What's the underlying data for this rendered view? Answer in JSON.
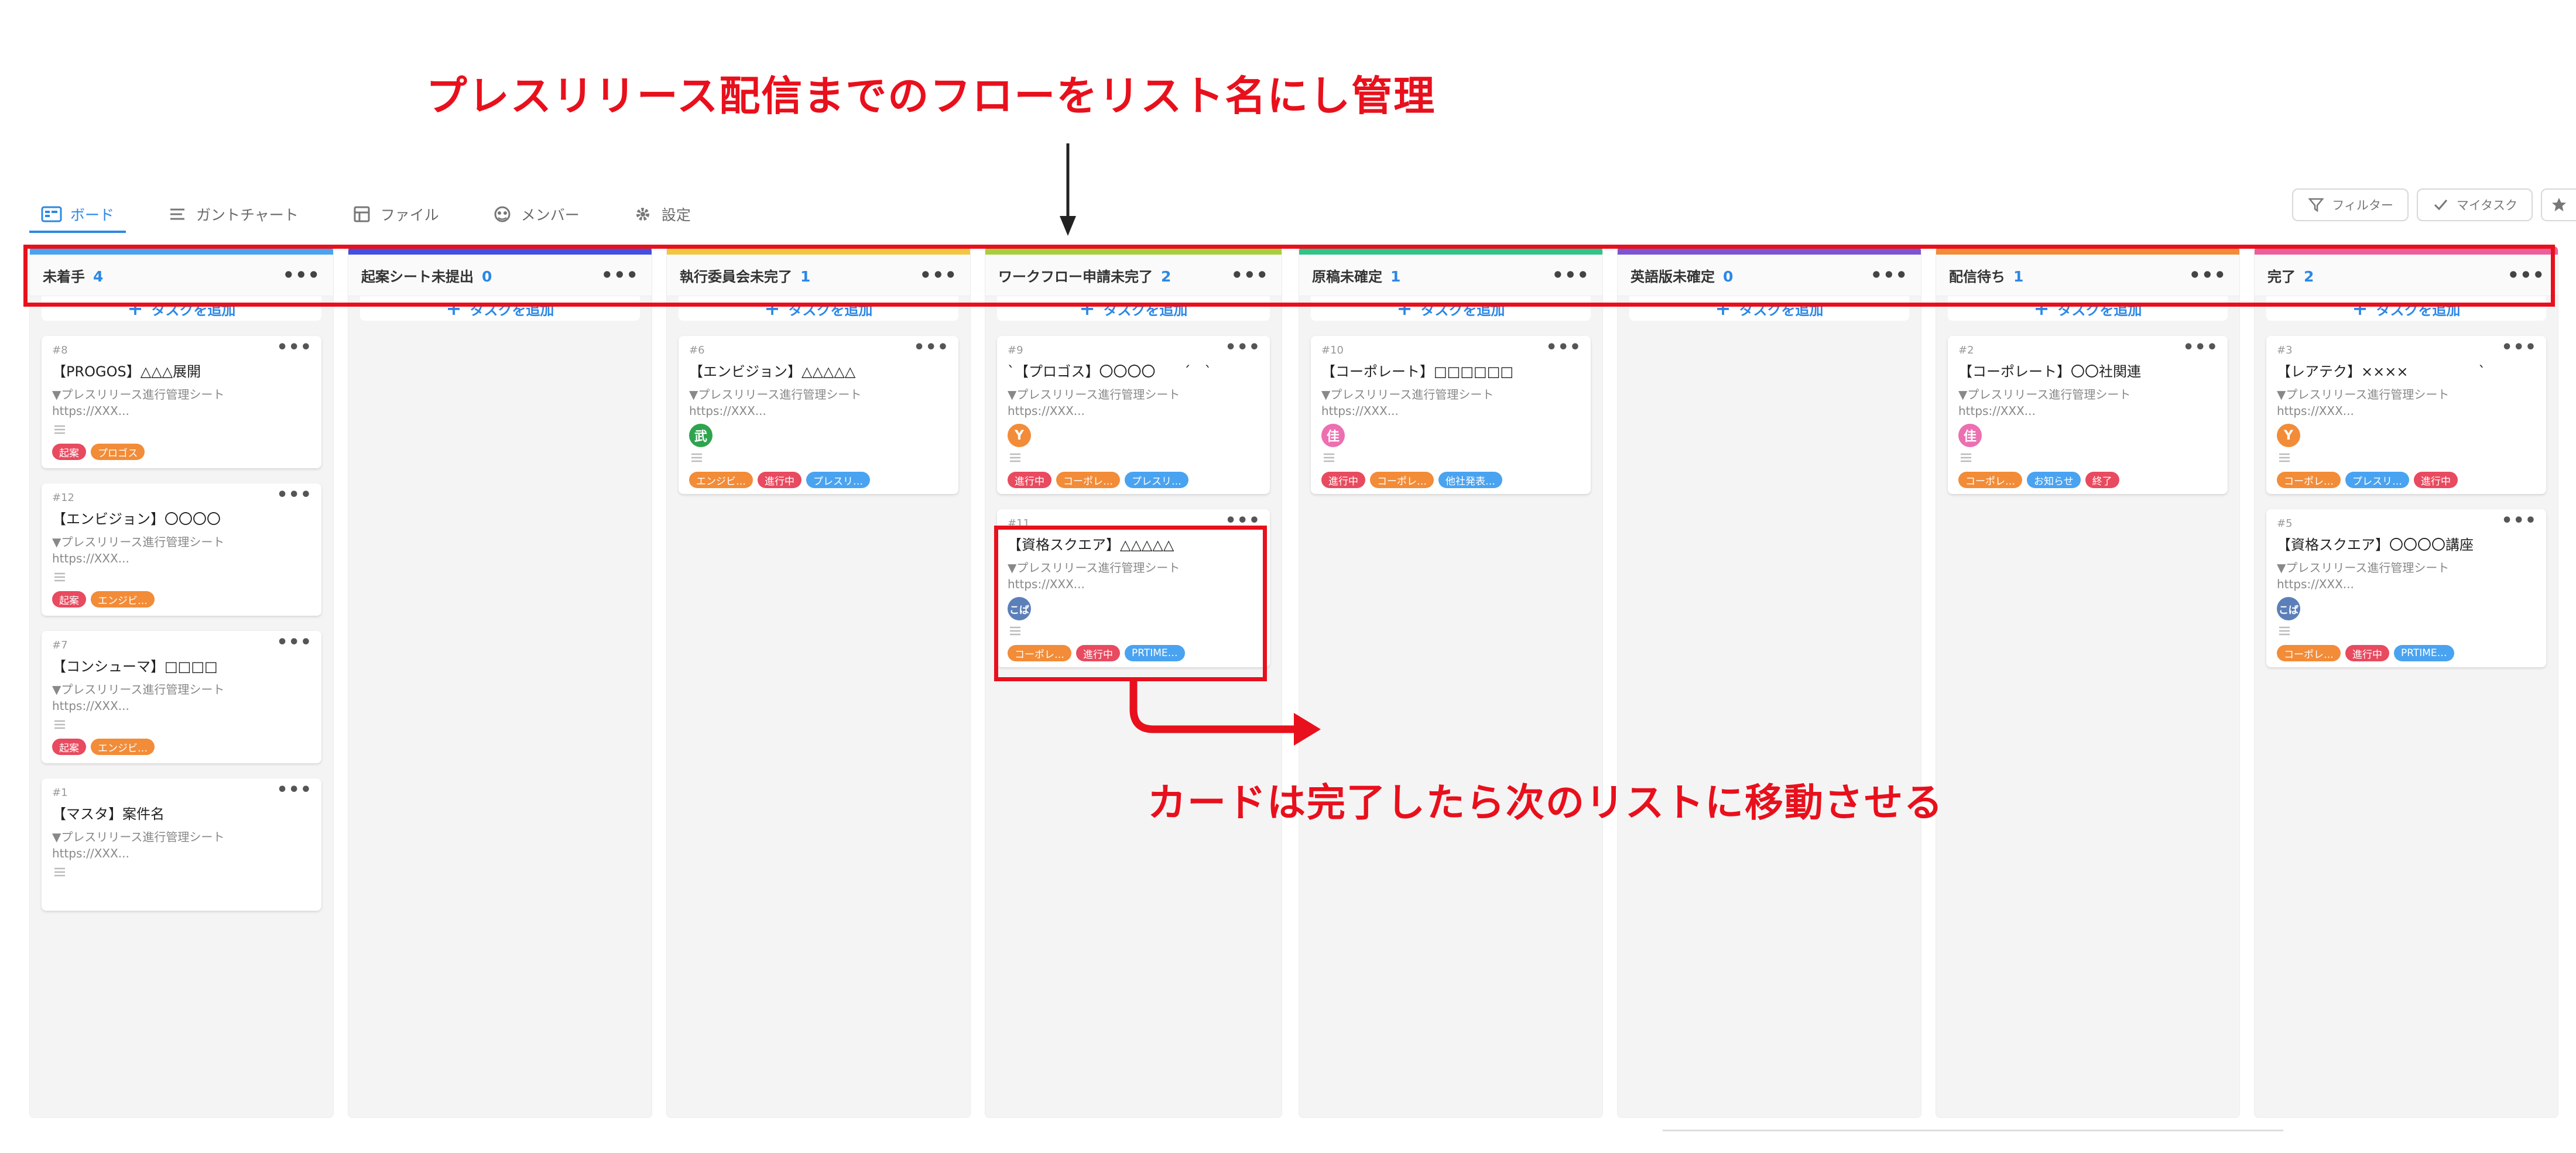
{
  "annotations": {
    "top": "プレスリリース配信までのフローをリスト名にし管理",
    "bottom": "カードは完了したら次のリストに移動させる"
  },
  "tabs": [
    {
      "label": "ボード",
      "icon": "board-icon"
    },
    {
      "label": "ガントチャート",
      "icon": "gantt-list-icon"
    },
    {
      "label": "ファイル",
      "icon": "file-icon"
    },
    {
      "label": "メンバー",
      "icon": "members-icon"
    },
    {
      "label": "設定",
      "icon": "gear-icon"
    }
  ],
  "tools": {
    "filter": "フィルター",
    "mytask": "マイタスク"
  },
  "add_task_label": "タスクを追加",
  "desc_line1": "▼プレスリリース進行管理シート",
  "desc_line2": "https://XXX...",
  "tag_colors": {
    "起案": "#e84a5f",
    "プロゴス": "#f28c38",
    "エンジビ…": "#f28c38",
    "進行中": "#e84a5f",
    "プレスリ…": "#4aa3f0",
    "コーポレ…": "#f28c38",
    "他社発表…": "#4aa3f0",
    "お知らせ": "#4aa3f0",
    "終了": "#e84a5f",
    "PRTIME…": "#4aa3f0"
  },
  "columns": [
    {
      "name": "未着手",
      "count": "4",
      "color": "#4aa3f0",
      "cards": [
        {
          "id": "#8",
          "title": "【PROGOS】△△△展開",
          "tags": [
            "起案",
            "プロゴス"
          ]
        },
        {
          "id": "#12",
          "title": "【エンビジョン】〇〇〇〇",
          "tags": [
            "起案",
            "エンジビ…"
          ]
        },
        {
          "id": "#7",
          "title": "【コンシューマ】□□□□",
          "tags": [
            "起案",
            "エンジビ…"
          ]
        },
        {
          "id": "#1",
          "title": "【マスタ】案件名",
          "tags": []
        }
      ]
    },
    {
      "name": "起案シート未提出",
      "count": "0",
      "color": "#4450e0",
      "cards": []
    },
    {
      "name": "執行委員会未完了",
      "count": "1",
      "color": "#f2c740",
      "cards": [
        {
          "id": "#6",
          "title": "【エンビジョン】△△△△△",
          "avatar": "武",
          "avatar_color": "#2ea44f",
          "tags": [
            "エンジビ…",
            "進行中",
            "プレスリ…"
          ]
        }
      ]
    },
    {
      "name": "ワークフロー申請未完了",
      "count": "2",
      "color": "#a6cf3c",
      "cards": [
        {
          "id": "#9",
          "title": "ˋ【プロゴス】〇〇〇〇　　ˊ　ˋ",
          "avatar": "Y",
          "avatar_color": "#f28c38",
          "tags": [
            "進行中",
            "コーポレ…",
            "プレスリ…"
          ]
        },
        {
          "id": "#11",
          "title": "【資格スクエア】△△△△△",
          "avatar": "こば",
          "avatar_color": "#5b7fb8",
          "tags": [
            "コーポレ…",
            "進行中",
            "PRTIME…"
          ]
        }
      ]
    },
    {
      "name": "原稿未確定",
      "count": "1",
      "color": "#2fc48a",
      "cards": [
        {
          "id": "#10",
          "title": "【コーポレート】□□□□□□",
          "avatar": "佳",
          "avatar_color": "#ec6fb1",
          "tags": [
            "進行中",
            "コーポレ…",
            "他社発表…"
          ]
        }
      ]
    },
    {
      "name": "英語版未確定",
      "count": "0",
      "color": "#7a55d4",
      "cards": []
    },
    {
      "name": "配信待ち",
      "count": "1",
      "color": "#f28c38",
      "cards": [
        {
          "id": "#2",
          "title": "【コーポレート】〇〇社関連",
          "avatar": "佳",
          "avatar_color": "#ec6fb1",
          "tags": [
            "コーポレ…",
            "お知らせ",
            "終了"
          ]
        }
      ]
    },
    {
      "name": "完了",
      "count": "2",
      "color": "#ec5e9c",
      "cards": [
        {
          "id": "#3",
          "title": "【レアテク】××××　　　　　ˋ",
          "avatar": "Y",
          "avatar_color": "#f28c38",
          "tags": [
            "コーポレ…",
            "プレスリ…",
            "進行中"
          ]
        },
        {
          "id": "#5",
          "title": "【資格スクエア】〇〇〇〇講座",
          "avatar": "こば",
          "avatar_color": "#5b7fb8",
          "tags": [
            "コーポレ…",
            "進行中",
            "PRTIME…"
          ]
        }
      ]
    }
  ]
}
